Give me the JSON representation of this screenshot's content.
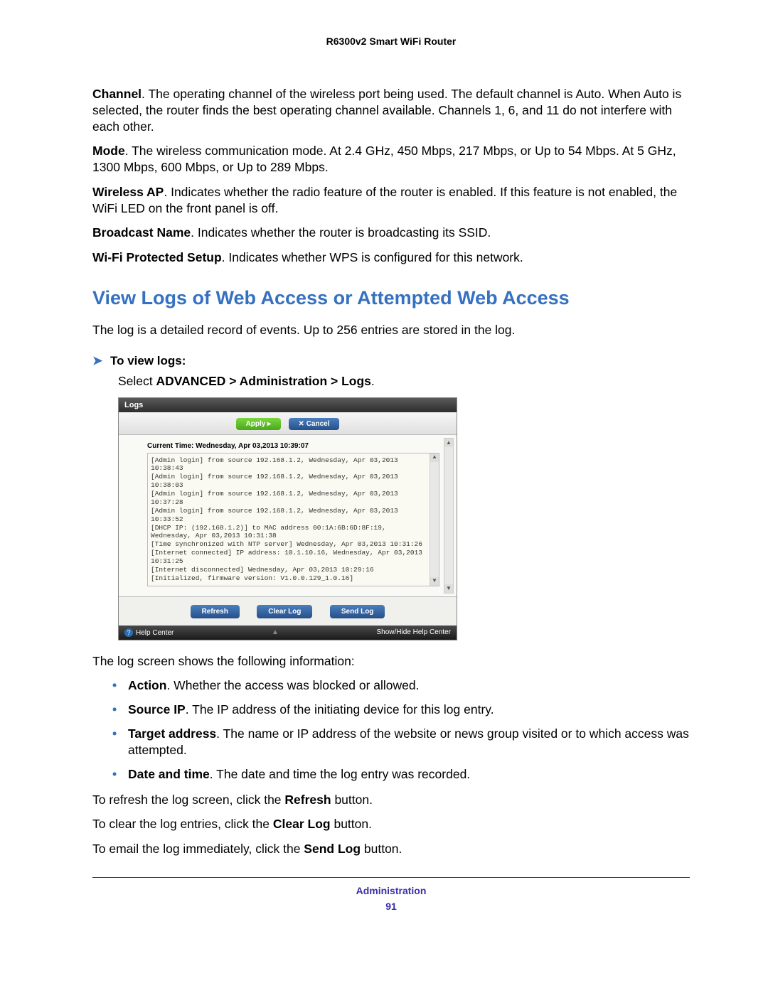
{
  "doc_header": "R6300v2 Smart WiFi Router",
  "paras": {
    "channel": {
      "label": "Channel",
      "text": ". The operating channel of the wireless port being used. The default channel is Auto. When Auto is selected, the router finds the best operating channel available. Channels 1, 6, and 11 do not interfere with each other."
    },
    "mode": {
      "label": "Mode",
      "text": ". The wireless communication mode. At 2.4 GHz, 450 Mbps, 217 Mbps, or Up to 54 Mbps. At 5 GHz, 1300 Mbps, 600 Mbps, or Up to 289 Mbps."
    },
    "wap": {
      "label": "Wireless AP",
      "text": ". Indicates whether the radio feature of the router is enabled. If this feature is not enabled, the WiFi LED on the front panel is off."
    },
    "bname": {
      "label": "Broadcast Name",
      "text": ". Indicates whether the router is broadcasting its SSID."
    },
    "wps": {
      "label": "Wi-Fi Protected Setup",
      "text": ". Indicates whether WPS is configured for this network."
    }
  },
  "section_heading": "View Logs of Web Access or Attempted Web Access",
  "intro_para": "The log is a detailed record of events. Up to 256 entries are stored in the log.",
  "proc": {
    "title": "To view logs:",
    "step_prefix": "Select ",
    "step_bold": "ADVANCED > Administration > Logs",
    "step_suffix": "."
  },
  "screenshot": {
    "title": "Logs",
    "apply": "Apply ▸",
    "cancel": "✕ Cancel",
    "current_time": "Current Time: Wednesday, Apr 03,2013 10:39:07",
    "log_lines": [
      "[Admin login] from source 192.168.1.2, Wednesday, Apr 03,2013 10:38:43",
      "[Admin login] from source 192.168.1.2, Wednesday, Apr 03,2013 10:38:03",
      "[Admin login] from source 192.168.1.2, Wednesday, Apr 03,2013 10:37:28",
      "[Admin login] from source 192.168.1.2, Wednesday, Apr 03,2013 10:33:52",
      "[DHCP IP: (192.168.1.2)] to MAC address 00:1A:6B:6D:8F:19, Wednesday, Apr 03,2013 10:31:38",
      "[Time synchronized with NTP server] Wednesday, Apr 03,2013 10:31:26",
      "[Internet connected] IP address: 10.1.10.16, Wednesday, Apr 03,2013 10:31:25",
      "[Internet disconnected] Wednesday, Apr 03,2013 10:29:16",
      "[Initialized, firmware version: V1.0.0.129_1.0.16]"
    ],
    "refresh": "Refresh",
    "clear": "Clear Log",
    "send": "Send Log",
    "help_center": "Help Center",
    "showhide": "Show/Hide Help Center"
  },
  "after_ss": "The log screen shows the following information:",
  "bullets": [
    {
      "label": "Action",
      "text": ". Whether the access was blocked or allowed."
    },
    {
      "label": "Source IP",
      "text": ". The IP address of the initiating device for this log entry."
    },
    {
      "label": "Target address",
      "text": ". The name or IP address of the website or news group visited or to which access was attempted."
    },
    {
      "label": "Date and time",
      "text": ". The date and time the log entry was recorded."
    }
  ],
  "tail": {
    "refresh_pre": "To refresh the log screen, click the ",
    "refresh_bold": "Refresh",
    "refresh_post": " button.",
    "clear_pre": "To clear the log entries, click the ",
    "clear_bold": "Clear Log",
    "clear_post": " button.",
    "send_pre": "To email the log immediately, click the ",
    "send_bold": "Send Log",
    "send_post": " button."
  },
  "footer": {
    "label": "Administration",
    "page": "91"
  }
}
